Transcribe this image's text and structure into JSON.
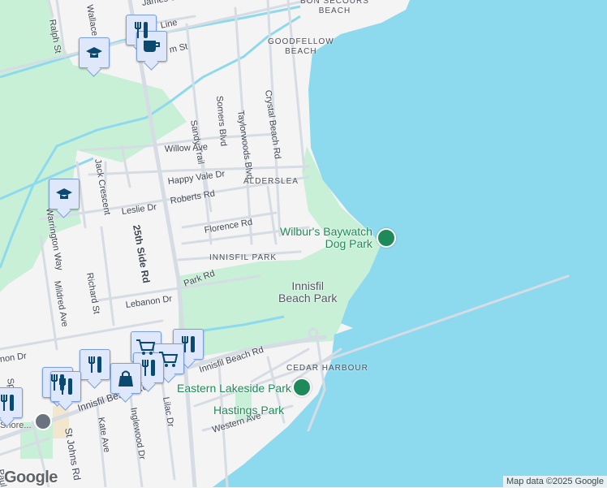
{
  "map": {
    "colors": {
      "water": "#8ddaee",
      "land": "#f5f4f4",
      "park": "#c8f0d6",
      "road": "#d6dce4",
      "creek": "#8ddaee",
      "poi_green": "#1e8a5a"
    },
    "streets": [
      "James St",
      "Line",
      "Ralph St",
      "Wallace Ave",
      "25th Side Rd",
      "m St",
      "Sandy Trail",
      "Somers Blvd",
      "Taylorwoods Blvd",
      "Crystal Beach Rd",
      "Jack Crescent",
      "Willow Ave",
      "Happy Vale Dr",
      "Warrington Way",
      "Leslie Dr",
      "Roberts Rd",
      "Florence Rd",
      "Richard St",
      "Mildred Ave",
      "Park Rd",
      "Lebanon Dr",
      "non Dr",
      "Spri",
      "Innisfil Beach Rd",
      "Innisfil Beach Rd",
      "St Johns Rd",
      "Kate Ave",
      "Inglewood Dr",
      "Lilac Dr",
      "Western Ave",
      "Paul"
    ],
    "areas": [
      "BON SECOURS\nBEACH",
      "GOODFELLOW\nBEACH",
      "ALDERSLEA",
      "INNISFIL PARK",
      "CEDAR HARBOUR"
    ],
    "parks": {
      "baywatch": "Wilbur's Baywatch\nDog Park",
      "innisfil_beach": "Innisfil\nBeach Park",
      "eastern": "Eastern Lakeside Park",
      "hastings": "Hastings Park"
    },
    "library": "...AB\nShore...",
    "logo": "Google",
    "attribution": "Map data ©2025 Google"
  }
}
